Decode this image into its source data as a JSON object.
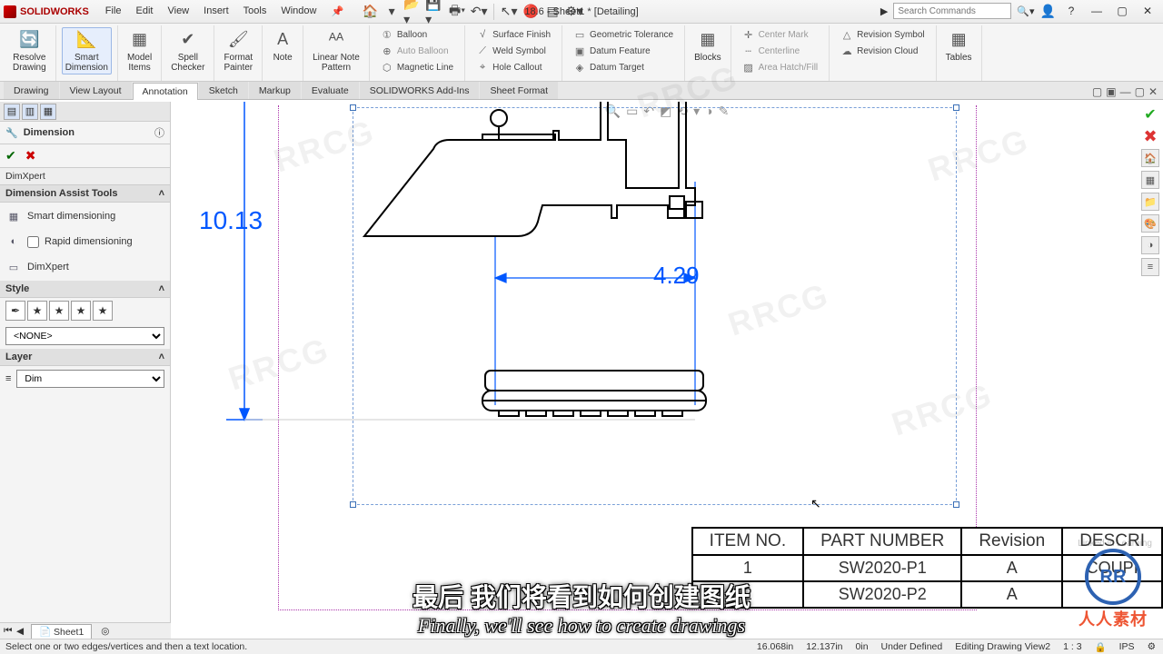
{
  "app": {
    "brand": "SOLIDWORKS",
    "title_center": "18.6 - Sheet1 * [Detailing]",
    "search_placeholder": "Search Commands"
  },
  "menus": [
    "File",
    "Edit",
    "View",
    "Insert",
    "Tools",
    "Window"
  ],
  "ribbon": {
    "big": [
      {
        "l1": "Resolve",
        "l2": "Drawing"
      },
      {
        "l1": "Smart",
        "l2": "Dimension",
        "selected": true
      },
      {
        "l1": "Model",
        "l2": "Items"
      },
      {
        "l1": "Spell",
        "l2": "Checker"
      },
      {
        "l1": "Format",
        "l2": "Painter"
      },
      {
        "l1": "Note",
        "l2": ""
      },
      {
        "l1": "Linear Note",
        "l2": "Pattern"
      }
    ],
    "col1": [
      {
        "t": "Balloon"
      },
      {
        "t": "Auto Balloon",
        "dis": true
      },
      {
        "t": "Magnetic Line"
      }
    ],
    "col2": [
      {
        "t": "Surface Finish"
      },
      {
        "t": "Weld Symbol"
      },
      {
        "t": "Hole Callout"
      }
    ],
    "col3": [
      {
        "t": "Geometric Tolerance"
      },
      {
        "t": "Datum Feature"
      },
      {
        "t": "Datum Target"
      }
    ],
    "blocks_label": "Blocks",
    "col4": [
      {
        "t": "Center Mark",
        "dis": true
      },
      {
        "t": "Centerline",
        "dis": true
      },
      {
        "t": "Area Hatch/Fill",
        "dis": true
      }
    ],
    "col5": [
      {
        "t": "Revision Symbol"
      },
      {
        "t": "Revision Cloud"
      }
    ],
    "tables_label": "Tables"
  },
  "cmd_tabs": [
    {
      "t": "Drawing"
    },
    {
      "t": "View Layout"
    },
    {
      "t": "Annotation",
      "active": true
    },
    {
      "t": "Sketch"
    },
    {
      "t": "Markup"
    },
    {
      "t": "Evaluate"
    },
    {
      "t": "SOLIDWORKS Add-Ins"
    },
    {
      "t": "Sheet Format"
    }
  ],
  "pm": {
    "title": "Dimension",
    "dimxpert_tab": "DimXpert",
    "assist_header": "Dimension Assist Tools",
    "assist_items": [
      "Smart dimensioning",
      "Rapid dimensioning",
      "DimXpert"
    ],
    "style_header": "Style",
    "style_value": "<NONE>",
    "layer_header": "Layer",
    "layer_value": "Dim"
  },
  "dimensions": {
    "vertical": "10.13",
    "horizontal": "4.29"
  },
  "table": {
    "headers": [
      "ITEM NO.",
      "PART NUMBER",
      "Revision",
      "DESCRI"
    ],
    "rows": [
      {
        "no": "1",
        "pn": "SW2020-P1",
        "rev": "A",
        "desc": "COUPI"
      },
      {
        "no": "2",
        "pn": "SW2020-P2",
        "rev": "A",
        "desc": ""
      }
    ]
  },
  "sheet_tab": "Sheet1",
  "status": {
    "hint": "Select one or two edges/vertices and then a text location.",
    "x": "16.068in",
    "y": "12.137in",
    "z": "0in",
    "constraint": "Under Defined",
    "editing": "Editing Drawing View2",
    "scale": "1 : 3",
    "units": "IPS"
  },
  "subtitles": {
    "cn": "最后 我们将看到如何创建图纸",
    "en": "Finally, we'll see how to create drawings"
  },
  "watermark": "RRCG",
  "badge": "RR",
  "badge_txt": "人人素材",
  "linkedin": "Linked in Learning"
}
